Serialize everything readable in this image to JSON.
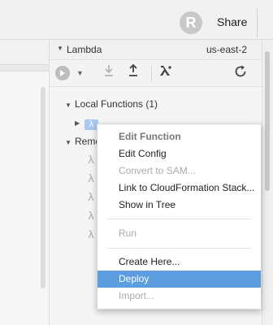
{
  "header": {
    "avatar_initial": "R",
    "share_label": "Share"
  },
  "panel": {
    "title": "Lambda",
    "region": "us-east-2"
  },
  "toolbar": {
    "run_icon": "play-icon",
    "dropdown_icon": "chevron-down-icon",
    "import_icon": "download-icon",
    "deploy_icon": "upload-icon",
    "create_icon": "lambda-icon",
    "refresh_icon": "refresh-icon"
  },
  "tree": {
    "local_functions_label": "Local Functions (1)",
    "remote_functions_label": "Remo",
    "local_function_glyph": "λ",
    "remote_function_glyph": "λ"
  },
  "context_menu": {
    "items": [
      {
        "label": "Edit Function",
        "state": "header"
      },
      {
        "label": "Edit Config",
        "state": "enabled"
      },
      {
        "label": "Convert to SAM...",
        "state": "disabled"
      },
      {
        "label": "Link to CloudFormation Stack...",
        "state": "enabled"
      },
      {
        "label": "Show in Tree",
        "state": "enabled"
      },
      {
        "label": "Run",
        "state": "disabled"
      },
      {
        "label": "Create Here...",
        "state": "enabled"
      },
      {
        "label": "Deploy",
        "state": "selected"
      },
      {
        "label": "Import...",
        "state": "disabled"
      }
    ]
  },
  "colors": {
    "selection": "#5b9ddf",
    "disabled_text": "#aaaaaa",
    "function_chip": "#a9c9f0"
  }
}
